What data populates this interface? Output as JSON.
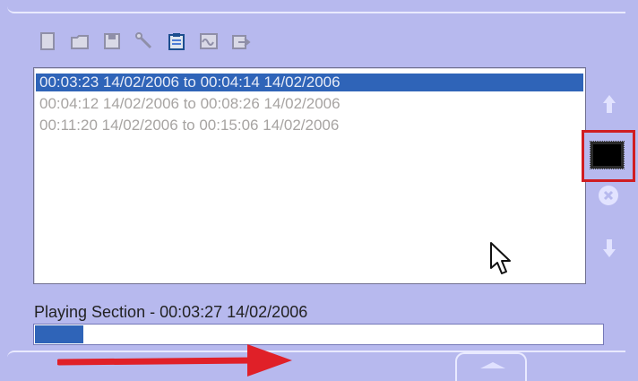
{
  "playlist": {
    "items": [
      {
        "label": "00:03:23 14/02/2006 to 00:04:14 14/02/2006",
        "selected": true
      },
      {
        "label": "00:04:12 14/02/2006 to 00:08:26 14/02/2006",
        "selected": false
      },
      {
        "label": "00:11:20 14/02/2006 to 00:15:06 14/02/2006",
        "selected": false
      }
    ]
  },
  "status": {
    "text": "Playing Section - 00:03:27 14/02/2006"
  },
  "progress": {
    "fraction": 0.085
  },
  "colors": {
    "panel": "#b7b9ee",
    "selection": "#2f64b8",
    "highlight_box": "#d01d22",
    "annotation_arrow": "#e02028"
  },
  "toolbar": {
    "icons": [
      "new-icon",
      "open-folder-icon",
      "save-icon",
      "wrench-icon",
      "clipboard-icon",
      "waveform-icon",
      "export-icon"
    ]
  },
  "side_controls": {
    "icons": [
      "up-arrow-icon",
      "stop-icon",
      "delete-icon",
      "down-arrow-icon"
    ]
  }
}
